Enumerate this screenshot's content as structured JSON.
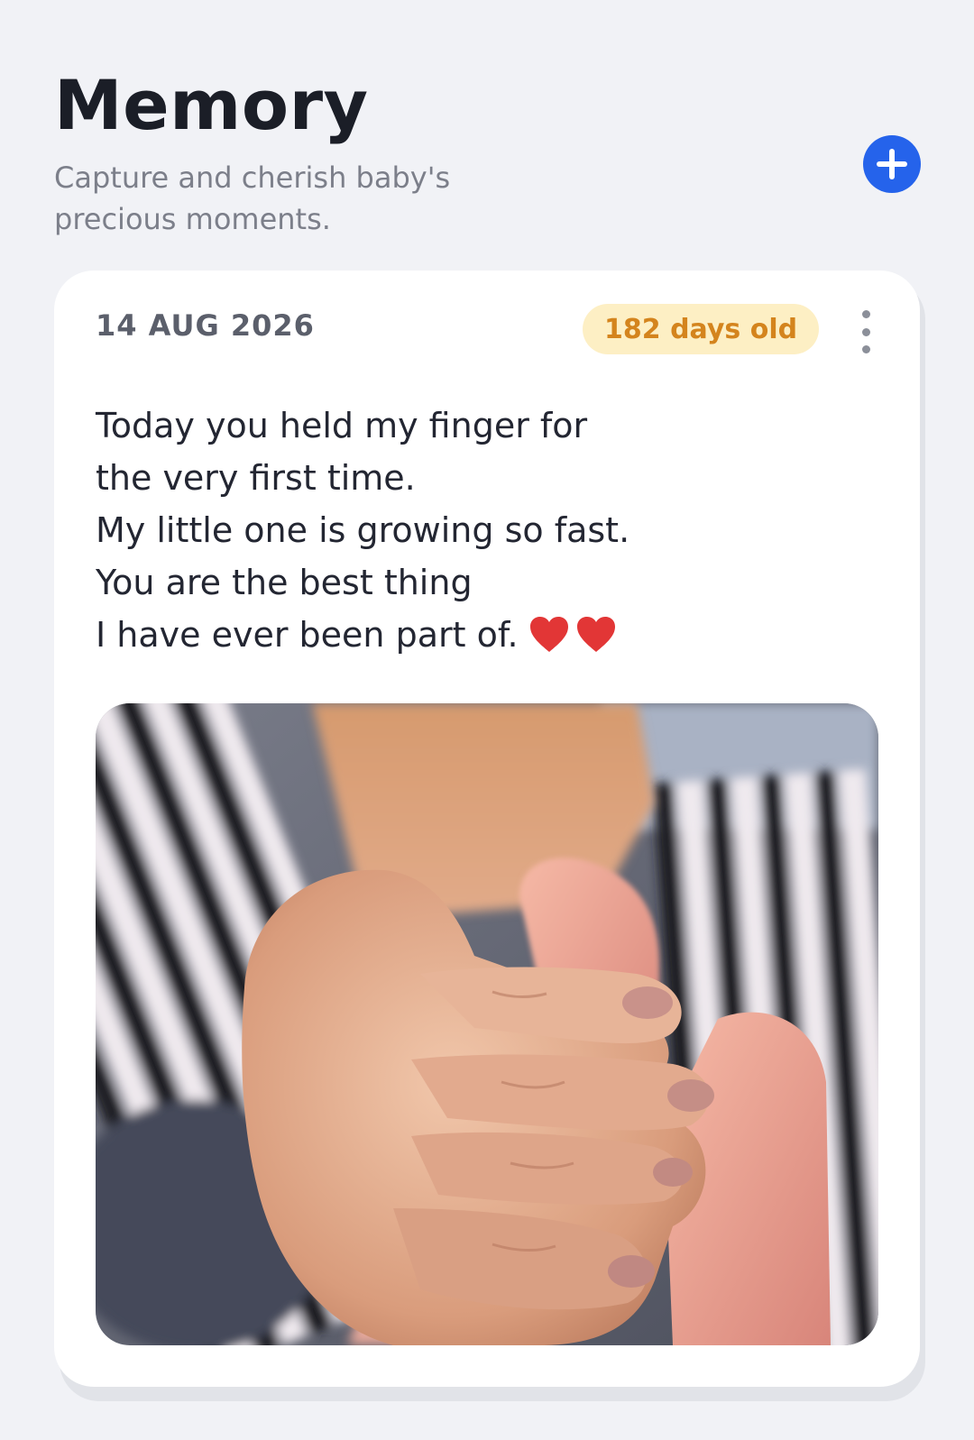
{
  "header": {
    "title": "Memory",
    "subtitle": "Capture and cherish baby's precious moments."
  },
  "add_button": {
    "icon": "plus-icon",
    "color": "#2563eb"
  },
  "memory_card": {
    "date": "14 AUG 2026",
    "age_badge": "182 days old",
    "more_icon": "more-vertical-icon",
    "text_lines": [
      "Today you held my finger for",
      "the very first time.",
      "My little one is growing so fast.",
      "You are the best thing",
      "I have ever been part of."
    ],
    "hearts": [
      "heart-icon",
      "heart-icon"
    ],
    "heart_color": "#e23636",
    "photo": "baby-hand-holding-finger-photo"
  }
}
